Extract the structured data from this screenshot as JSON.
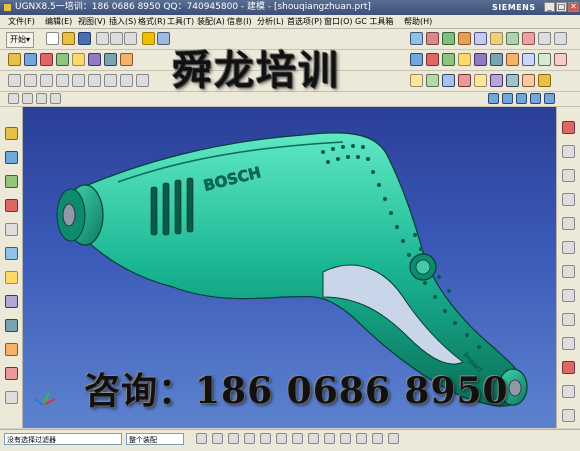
{
  "window": {
    "title": "UGNX8.5一培训：186 0686 8950 QQ：740945800 - 建模 - [shouqiangzhuan.prt]",
    "brand": "SIEMENS",
    "controls": [
      "_",
      "□",
      "✕"
    ]
  },
  "menu": {
    "items": [
      {
        "label": "文件(F)"
      },
      {
        "label": "编辑(E)"
      },
      {
        "label": "视图(V)"
      },
      {
        "label": "插入(S)"
      },
      {
        "label": "格式(R)"
      },
      {
        "label": "工具(T)"
      },
      {
        "label": "装配(A)"
      },
      {
        "label": "信息(I)"
      },
      {
        "label": "分析(L)"
      },
      {
        "label": "首选项(P)"
      },
      {
        "label": "窗口(O)"
      },
      {
        "label": "GC 工具箱"
      },
      {
        "label": "帮助(H)"
      }
    ]
  },
  "toolbar": {
    "start_label": "开始▾"
  },
  "model": {
    "brand_text": "BOSCH",
    "label_text": "Impact",
    "body_color": "#19b592"
  },
  "watermarks": {
    "title": "舜龙培训",
    "phone": "咨询：186 0686 8950"
  },
  "statusbar": {
    "filter_select": "没有选择过滤器",
    "scope_select": "整个装配"
  }
}
